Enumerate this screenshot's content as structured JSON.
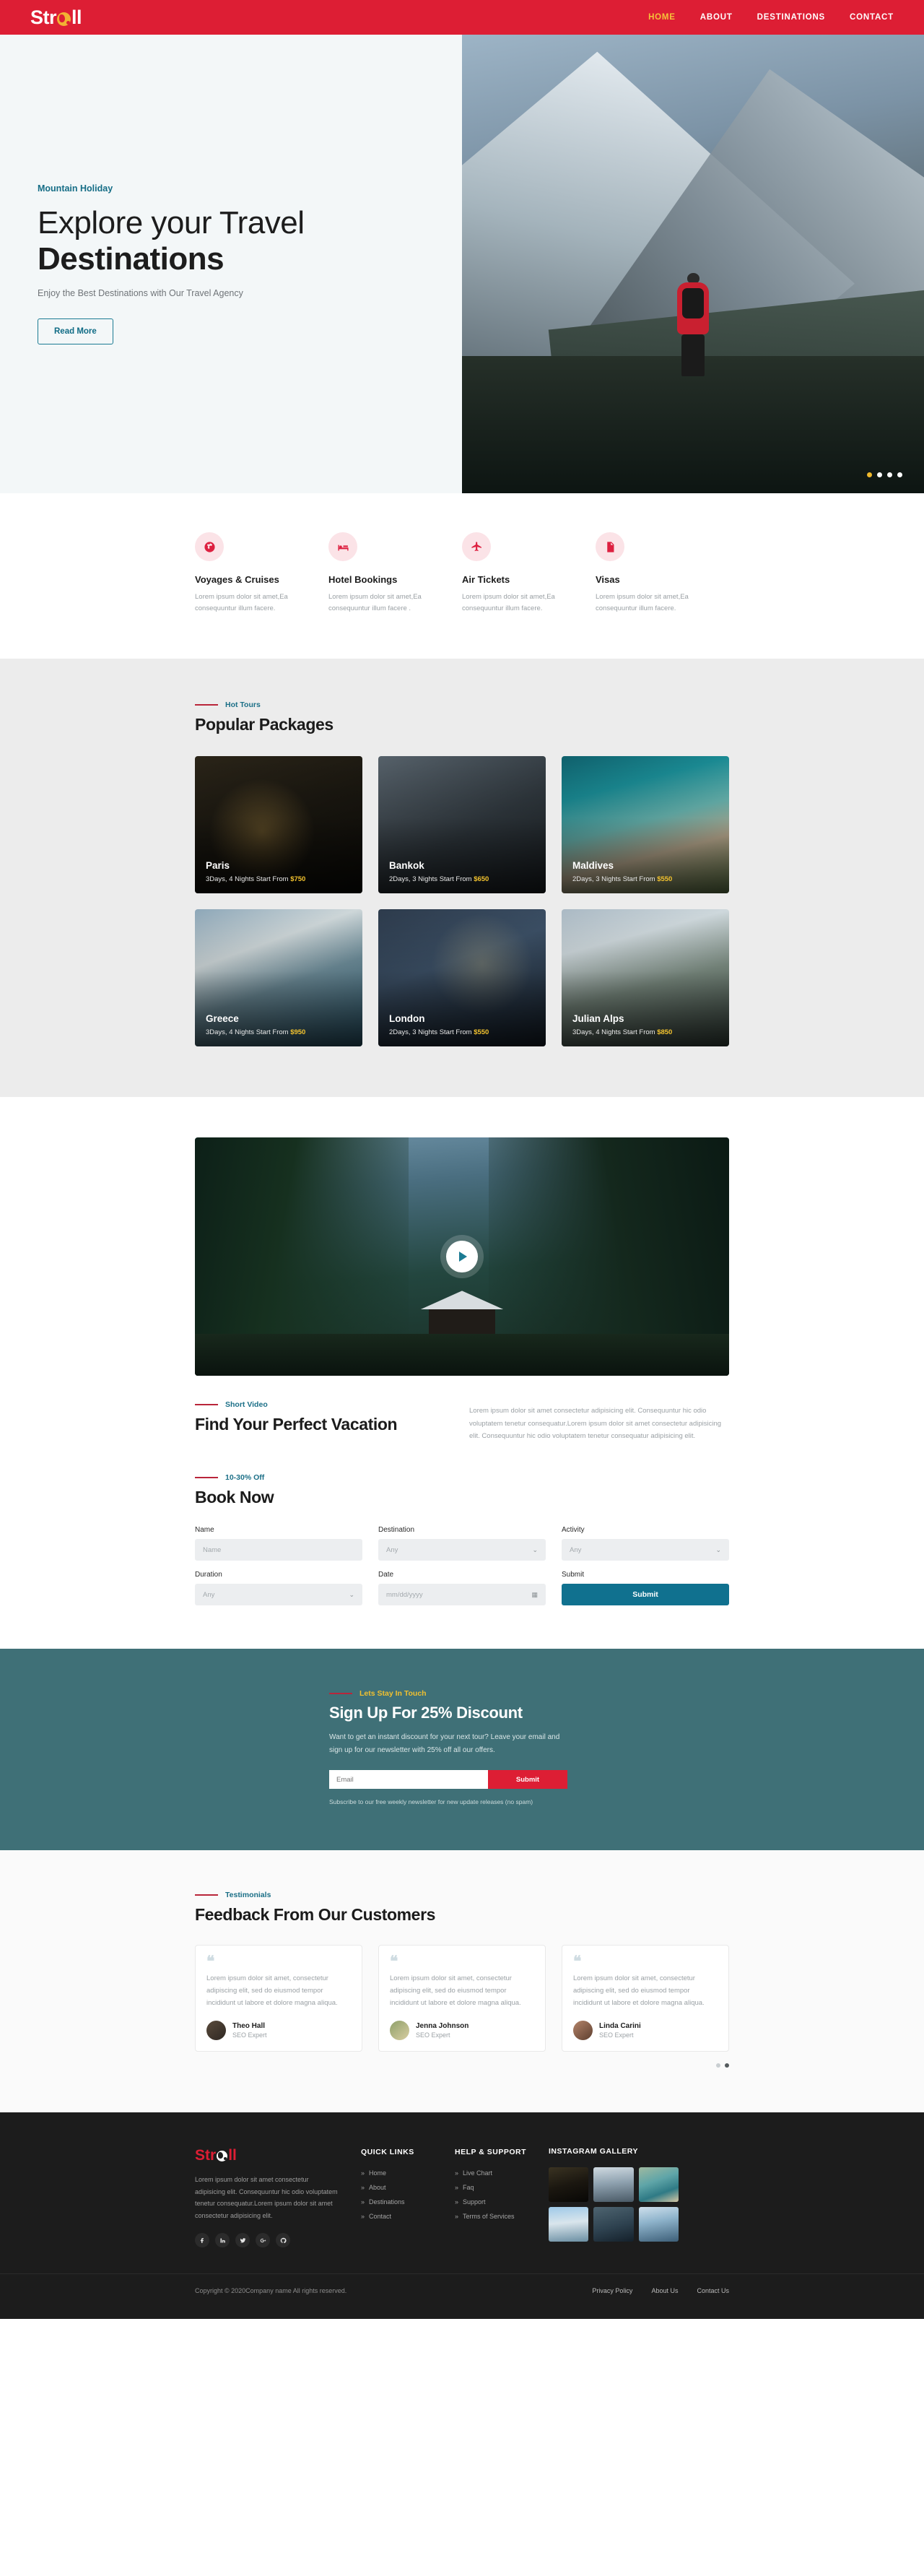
{
  "brand": {
    "name_left": "Str",
    "name_right": "ll",
    "globe_icon": "globe-icon"
  },
  "nav": {
    "items": [
      {
        "label": "HOME",
        "active": true
      },
      {
        "label": "ABOUT",
        "active": false
      },
      {
        "label": "DESTINATIONS",
        "active": false
      },
      {
        "label": "CONTACT",
        "active": false
      }
    ]
  },
  "hero": {
    "kicker": "Mountain Holiday",
    "title_line1": "Explore your Travel",
    "title_line2": "Destinations",
    "subtitle": "Enjoy the Best Destinations with Our Travel Agency",
    "cta": "Read More",
    "slides_total": 4,
    "active_slide": 1
  },
  "services": {
    "items": [
      {
        "icon": "globe-icon",
        "title": "Voyages & Cruises",
        "text": "Lorem ipsum dolor sit amet,Ea consequuntur illum facere."
      },
      {
        "icon": "bed-icon",
        "title": "Hotel Bookings",
        "text": "Lorem ipsum dolor sit amet,Ea consequuntur illum facere ."
      },
      {
        "icon": "plane-icon",
        "title": "Air Tickets",
        "text": "Lorem ipsum dolor sit amet,Ea consequuntur illum facere."
      },
      {
        "icon": "document-icon",
        "title": "Visas",
        "text": "Lorem ipsum dolor sit amet,Ea consequuntur illum facere."
      }
    ]
  },
  "packages": {
    "kicker": "Hot Tours",
    "heading": "Popular Packages",
    "cards": [
      {
        "name": "Paris",
        "meta": "3Days, 4 Nights Start From ",
        "price": "$750"
      },
      {
        "name": "Bankok",
        "meta": "2Days, 3 Nights Start From ",
        "price": "$650"
      },
      {
        "name": "Maldives",
        "meta": "2Days, 3 Nights Start From ",
        "price": "$550"
      },
      {
        "name": "Greece",
        "meta": "3Days, 4 Nights Start From ",
        "price": "$950"
      },
      {
        "name": "London",
        "meta": "2Days, 3 Nights Start From ",
        "price": "$550"
      },
      {
        "name": "Julian Alps",
        "meta": "3Days, 4 Nights Start From ",
        "price": "$850"
      }
    ]
  },
  "video": {
    "play_icon": "play-icon",
    "kicker": "Short Video",
    "heading": "Find Your Perfect Vacation",
    "paragraph": "Lorem ipsum dolor sit amet consectetur adipisicing elit. Consequuntur hic odio voluptatem tenetur consequatur.Lorem ipsum dolor sit amet consectetur adipisicing elit. Consequuntur hic odio voluptatem tenetur consequatur adipisicing elit."
  },
  "book": {
    "kicker": "10-30% Off",
    "heading": "Book Now",
    "fields": [
      {
        "label": "Name",
        "value": "Name",
        "type": "text"
      },
      {
        "label": "Destination",
        "value": "Any",
        "type": "select"
      },
      {
        "label": "Activity",
        "value": "Any",
        "type": "select"
      },
      {
        "label": "Duration",
        "value": "Any",
        "type": "select"
      },
      {
        "label": "Date",
        "value": "mm/dd/yyyy",
        "type": "date"
      }
    ],
    "submit_label": "Submit",
    "submit_field_label": "Submit",
    "calendar_icon": "calendar-icon",
    "chevron_icon": "chevron-down-icon"
  },
  "newsletter": {
    "kicker": "Lets Stay In Touch",
    "heading": "Sign Up For 25% Discount",
    "paragraph": "Want to get an instant discount for your next tour? Leave your email and sign up for our newsletter with 25% off all our offers.",
    "email_placeholder": "Email",
    "submit_label": "Submit",
    "note": "Subscribe to our free weekly newsletter for new update releases (no spam)",
    "bg_color": "#3f7077",
    "accent_color": "#dd1e34"
  },
  "testimonials": {
    "kicker": "Testimonials",
    "heading": "Feedback From Our Customers",
    "quote_icon": "quote-icon",
    "cards": [
      {
        "text": "Lorem ipsum dolor sit amet, consectetur adipiscing elit, sed do eiusmod tempor incididunt ut labore et dolore magna aliqua.",
        "name": "Theo Hall",
        "role": "SEO Expert"
      },
      {
        "text": "Lorem ipsum dolor sit amet, consectetur adipiscing elit, sed do eiusmod tempor incididunt ut labore et dolore magna aliqua.",
        "name": "Jenna Johnson",
        "role": "SEO Expert"
      },
      {
        "text": "Lorem ipsum dolor sit amet, consectetur adipiscing elit, sed do eiusmod tempor incididunt ut labore et dolore magna aliqua.",
        "name": "Linda Carini",
        "role": "SEO Expert"
      }
    ],
    "dots_total": 2,
    "active_dot": 2
  },
  "footer": {
    "about_text": "Lorem ipsum dolor sit amet consectetur adipisicing elit. Consequuntur hic odio voluptatem tenetur consequatur.Lorem ipsum dolor sit amet consectetur adipisicing elit.",
    "socials": [
      {
        "icon": "facebook-icon"
      },
      {
        "icon": "linkedin-icon"
      },
      {
        "icon": "twitter-icon"
      },
      {
        "icon": "google-plus-icon"
      },
      {
        "icon": "github-icon"
      }
    ],
    "quick_links": {
      "title": "QUICK LINKS",
      "items": [
        "Home",
        "About",
        "Destinations",
        "Contact"
      ]
    },
    "help": {
      "title": "HELP & SUPPORT",
      "items": [
        "Live Chart",
        "Faq",
        "Support",
        "Terms of Services"
      ]
    },
    "instagram": {
      "title": "INSTAGRAM GALLERY",
      "count": 6
    },
    "copyright": "Copyright © 2020Company name All rights reserved.",
    "links": [
      "Privacy Policy",
      "About Us",
      "Contact Us"
    ]
  }
}
